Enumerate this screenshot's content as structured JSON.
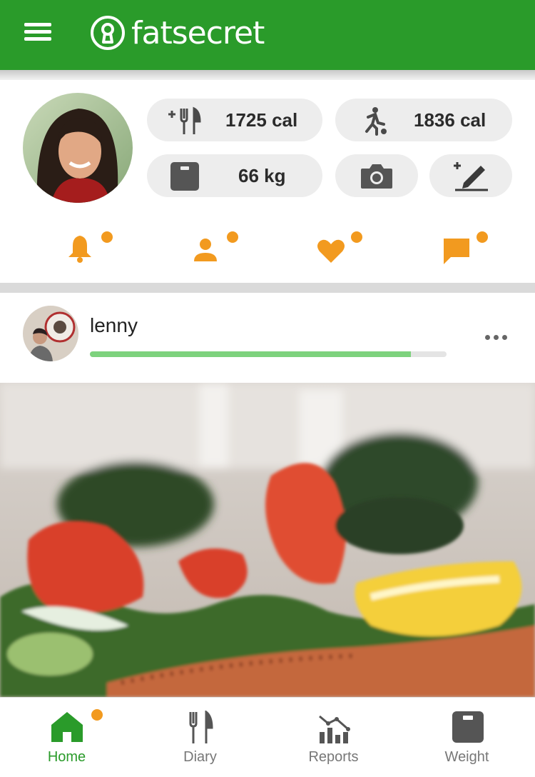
{
  "app": {
    "brand": "fatsecret",
    "accent_color": "#2a9b2a",
    "notification_color": "#f29a1f"
  },
  "header": {
    "menu_icon": "hamburger-menu-icon",
    "logo_icon": "keyhole-logo-icon"
  },
  "profile": {
    "avatar": "user-avatar-photo",
    "stats": {
      "food": {
        "icon": "add-food-icon",
        "value": "1725 cal"
      },
      "exercise": {
        "icon": "exercise-runner-icon",
        "value": "1836 cal"
      },
      "weight": {
        "icon": "scale-icon",
        "value": "66 kg"
      },
      "camera": {
        "icon": "camera-icon"
      },
      "edit": {
        "icon": "add-note-pencil-icon"
      }
    },
    "notifications": [
      {
        "icon": "bell-icon",
        "has_dot": true
      },
      {
        "icon": "person-icon",
        "has_dot": true
      },
      {
        "icon": "heart-icon",
        "has_dot": true
      },
      {
        "icon": "chat-bubble-icon",
        "has_dot": true
      }
    ]
  },
  "post": {
    "username": "lenny",
    "progress": 0.9,
    "more_icon": "more-dots-icon",
    "image": "salad-with-salmon-photo"
  },
  "bottom_nav": {
    "tabs": [
      {
        "label": "Home",
        "icon": "home-icon",
        "active": true,
        "has_dot": true
      },
      {
        "label": "Diary",
        "icon": "fork-knife-icon",
        "active": false
      },
      {
        "label": "Reports",
        "icon": "reports-chart-icon",
        "active": false
      },
      {
        "label": "Weight",
        "icon": "scale-icon",
        "active": false
      }
    ]
  }
}
